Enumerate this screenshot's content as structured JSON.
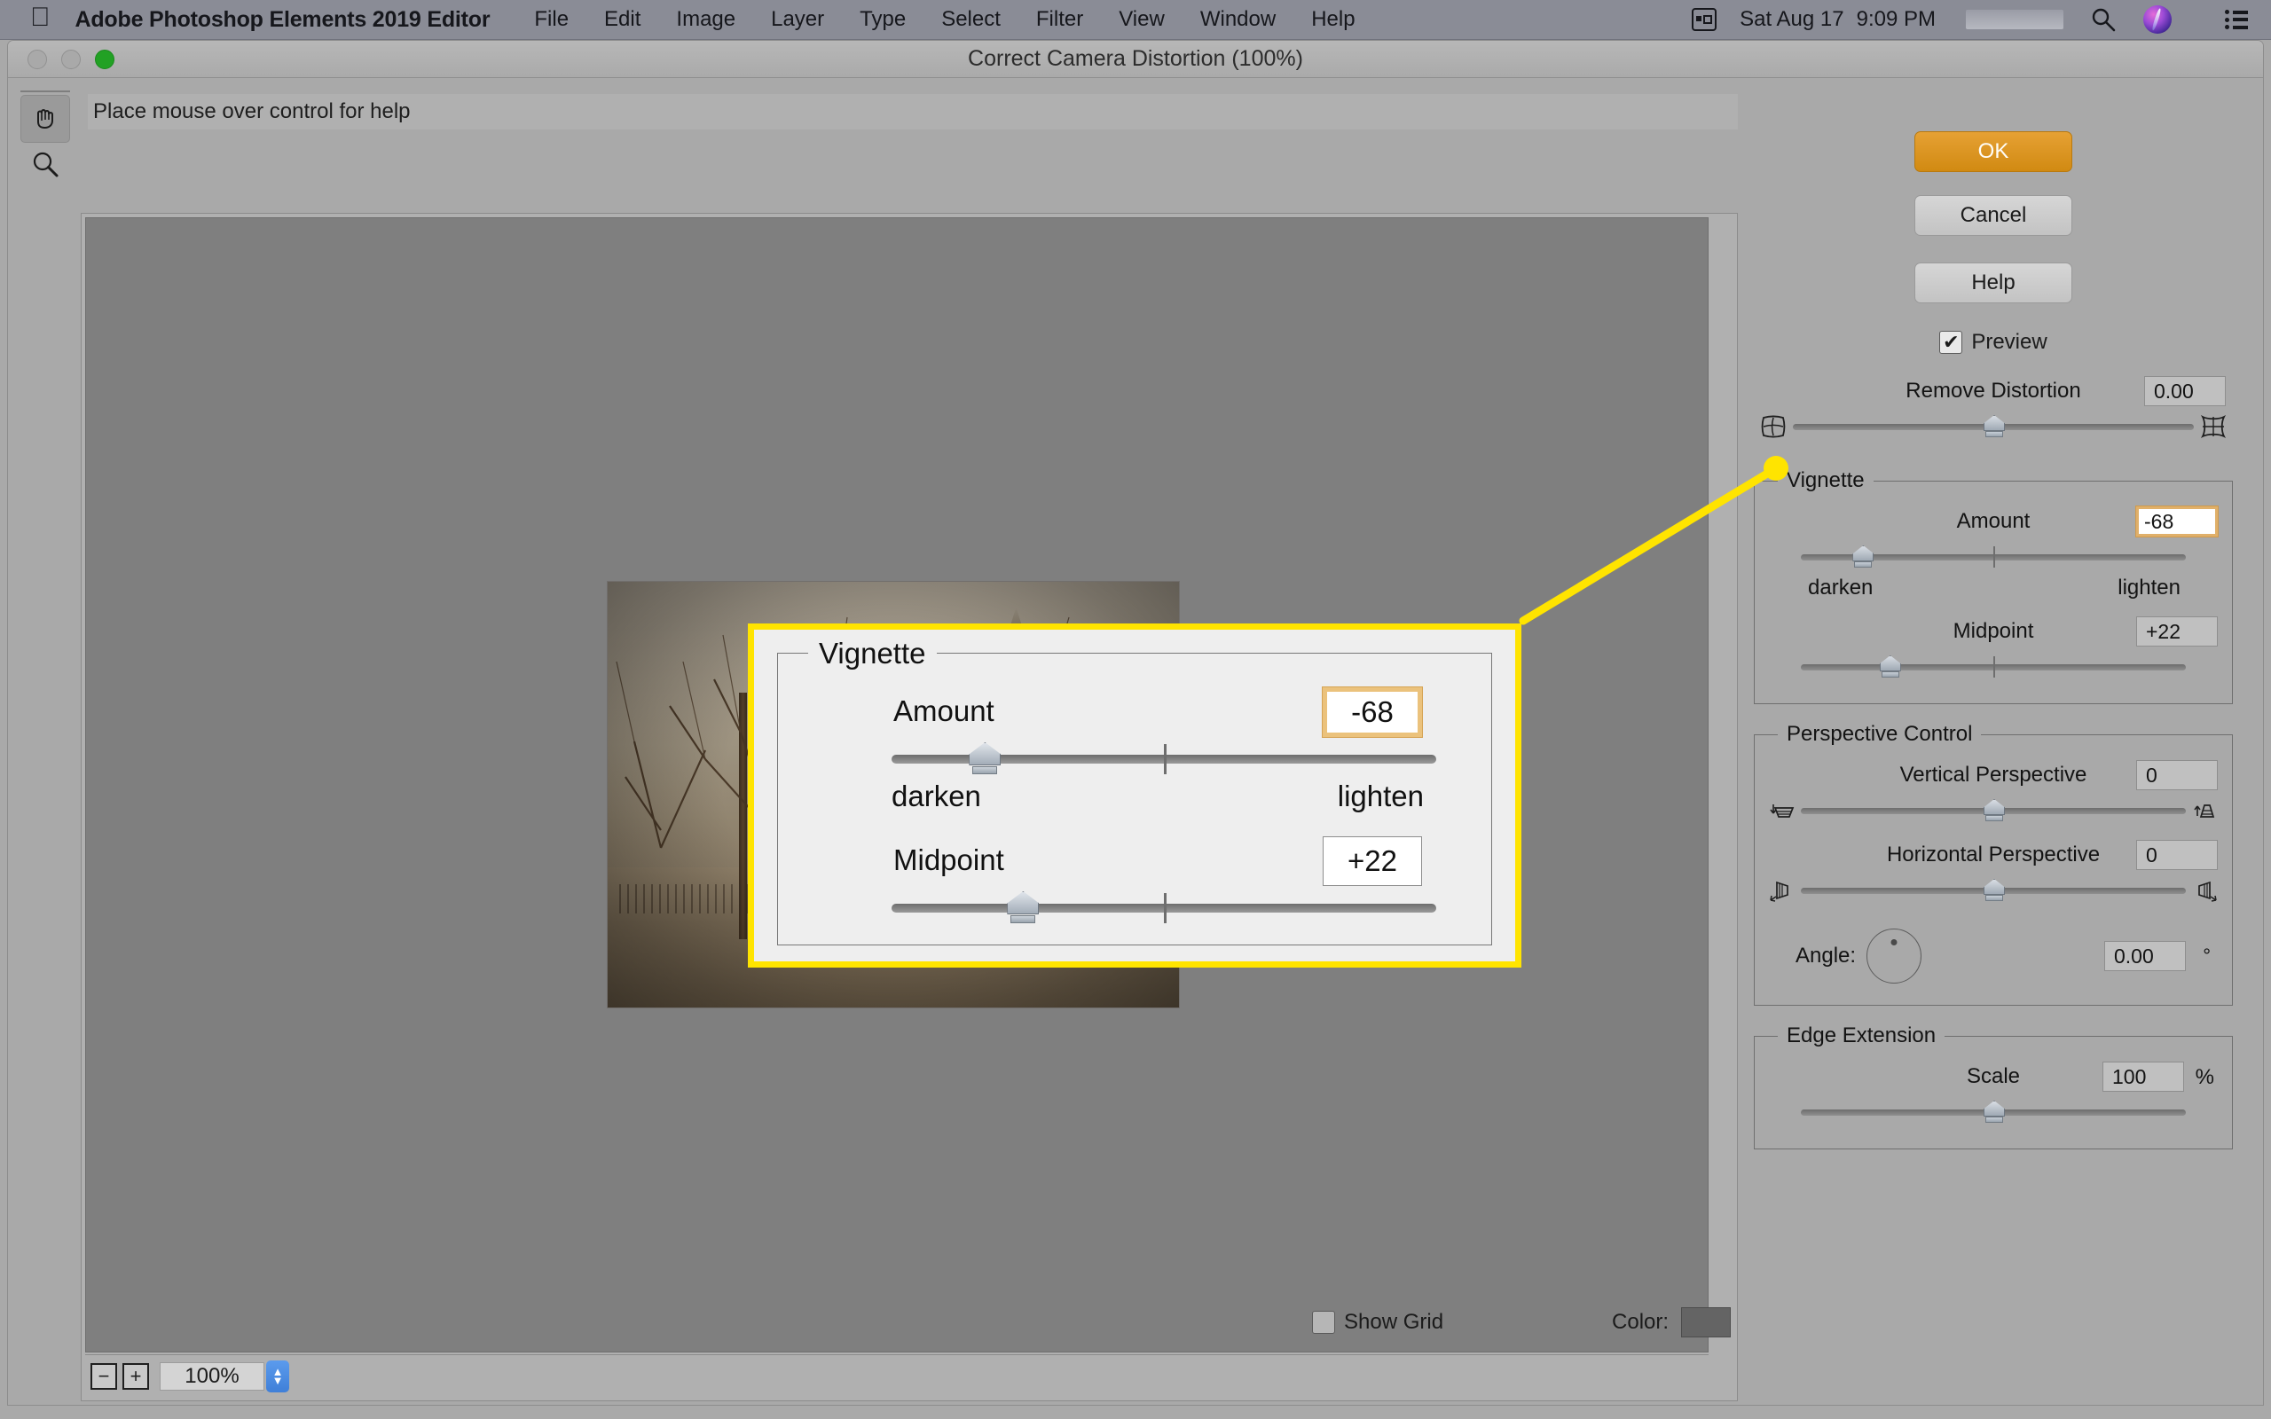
{
  "menubar": {
    "apple_logo": "apple-icon",
    "app_name": "Adobe Photoshop Elements 2019 Editor",
    "menus": [
      "File",
      "Edit",
      "Image",
      "Layer",
      "Type",
      "Select",
      "Filter",
      "View",
      "Window",
      "Help"
    ],
    "screen_icon": "screen-mirroring-icon",
    "date": "Sat Aug 17",
    "time": "9:09 PM",
    "search_icon": "search-icon",
    "siri_icon": "siri-icon",
    "control_center_icon": "control-center-icon"
  },
  "window": {
    "title": "Correct Camera Distortion (100%)",
    "close_button": "close-button",
    "minimize_button": "minimize-button",
    "zoom_button": "zoom-button"
  },
  "toolbar": {
    "hand_tool": "hand-tool-icon",
    "zoom_tool": "zoom-tool-icon"
  },
  "help_strip": {
    "text": "Place mouse over control for help"
  },
  "canvas": {
    "zoom_out_label": "−",
    "zoom_in_label": "+",
    "zoom_level": "100%",
    "stepper_up": "▲",
    "stepper_down": "▼"
  },
  "options": {
    "ok_label": "OK",
    "cancel_label": "Cancel",
    "help_label": "Help",
    "preview": {
      "label": "Preview",
      "checked": true,
      "check_glyph": "✔"
    },
    "remove_distortion": {
      "label": "Remove Distortion",
      "value": "0.00",
      "left_icon": "barrel-distortion-icon",
      "right_icon": "pincushion-distortion-icon",
      "thumb_pct": 50,
      "tick_pct": 50
    },
    "vignette": {
      "title": "Vignette",
      "amount": {
        "label": "Amount",
        "value": "-68",
        "highlighted": true,
        "thumb_pct": 16,
        "tick_pct": 50,
        "min_label": "darken",
        "max_label": "lighten"
      },
      "midpoint": {
        "label": "Midpoint",
        "value": "+22",
        "thumb_pct": 23,
        "tick_pct": 50
      }
    },
    "perspective": {
      "title": "Perspective Control",
      "vertical": {
        "label": "Vertical Perspective",
        "value": "0",
        "left_icon": "vertical-perspective-down-icon",
        "right_icon": "vertical-perspective-up-icon",
        "thumb_pct": 50,
        "tick_pct": 50
      },
      "horizontal": {
        "label": "Horizontal Perspective",
        "value": "0",
        "left_icon": "horizontal-perspective-left-icon",
        "right_icon": "horizontal-perspective-right-icon",
        "thumb_pct": 50,
        "tick_pct": 50
      },
      "angle": {
        "label": "Angle:",
        "value": "0.00",
        "unit": "°",
        "dial_icon": "angle-dial-icon"
      }
    },
    "edge_extension": {
      "title": "Edge Extension",
      "scale": {
        "label": "Scale",
        "value": "100",
        "unit": "%",
        "thumb_pct": 50
      }
    }
  },
  "bottom": {
    "show_grid": {
      "label": "Show Grid",
      "checked": false
    },
    "color_label": "Color:",
    "color_value": "#646464"
  },
  "callout": {
    "title": "Vignette",
    "amount_label": "Amount",
    "amount_value": "-68",
    "darken_label": "darken",
    "lighten_label": "lighten",
    "midpoint_label": "Midpoint",
    "midpoint_value": "+22",
    "accent_color": "#ffe400",
    "highlight_color": "#ebc27c"
  }
}
